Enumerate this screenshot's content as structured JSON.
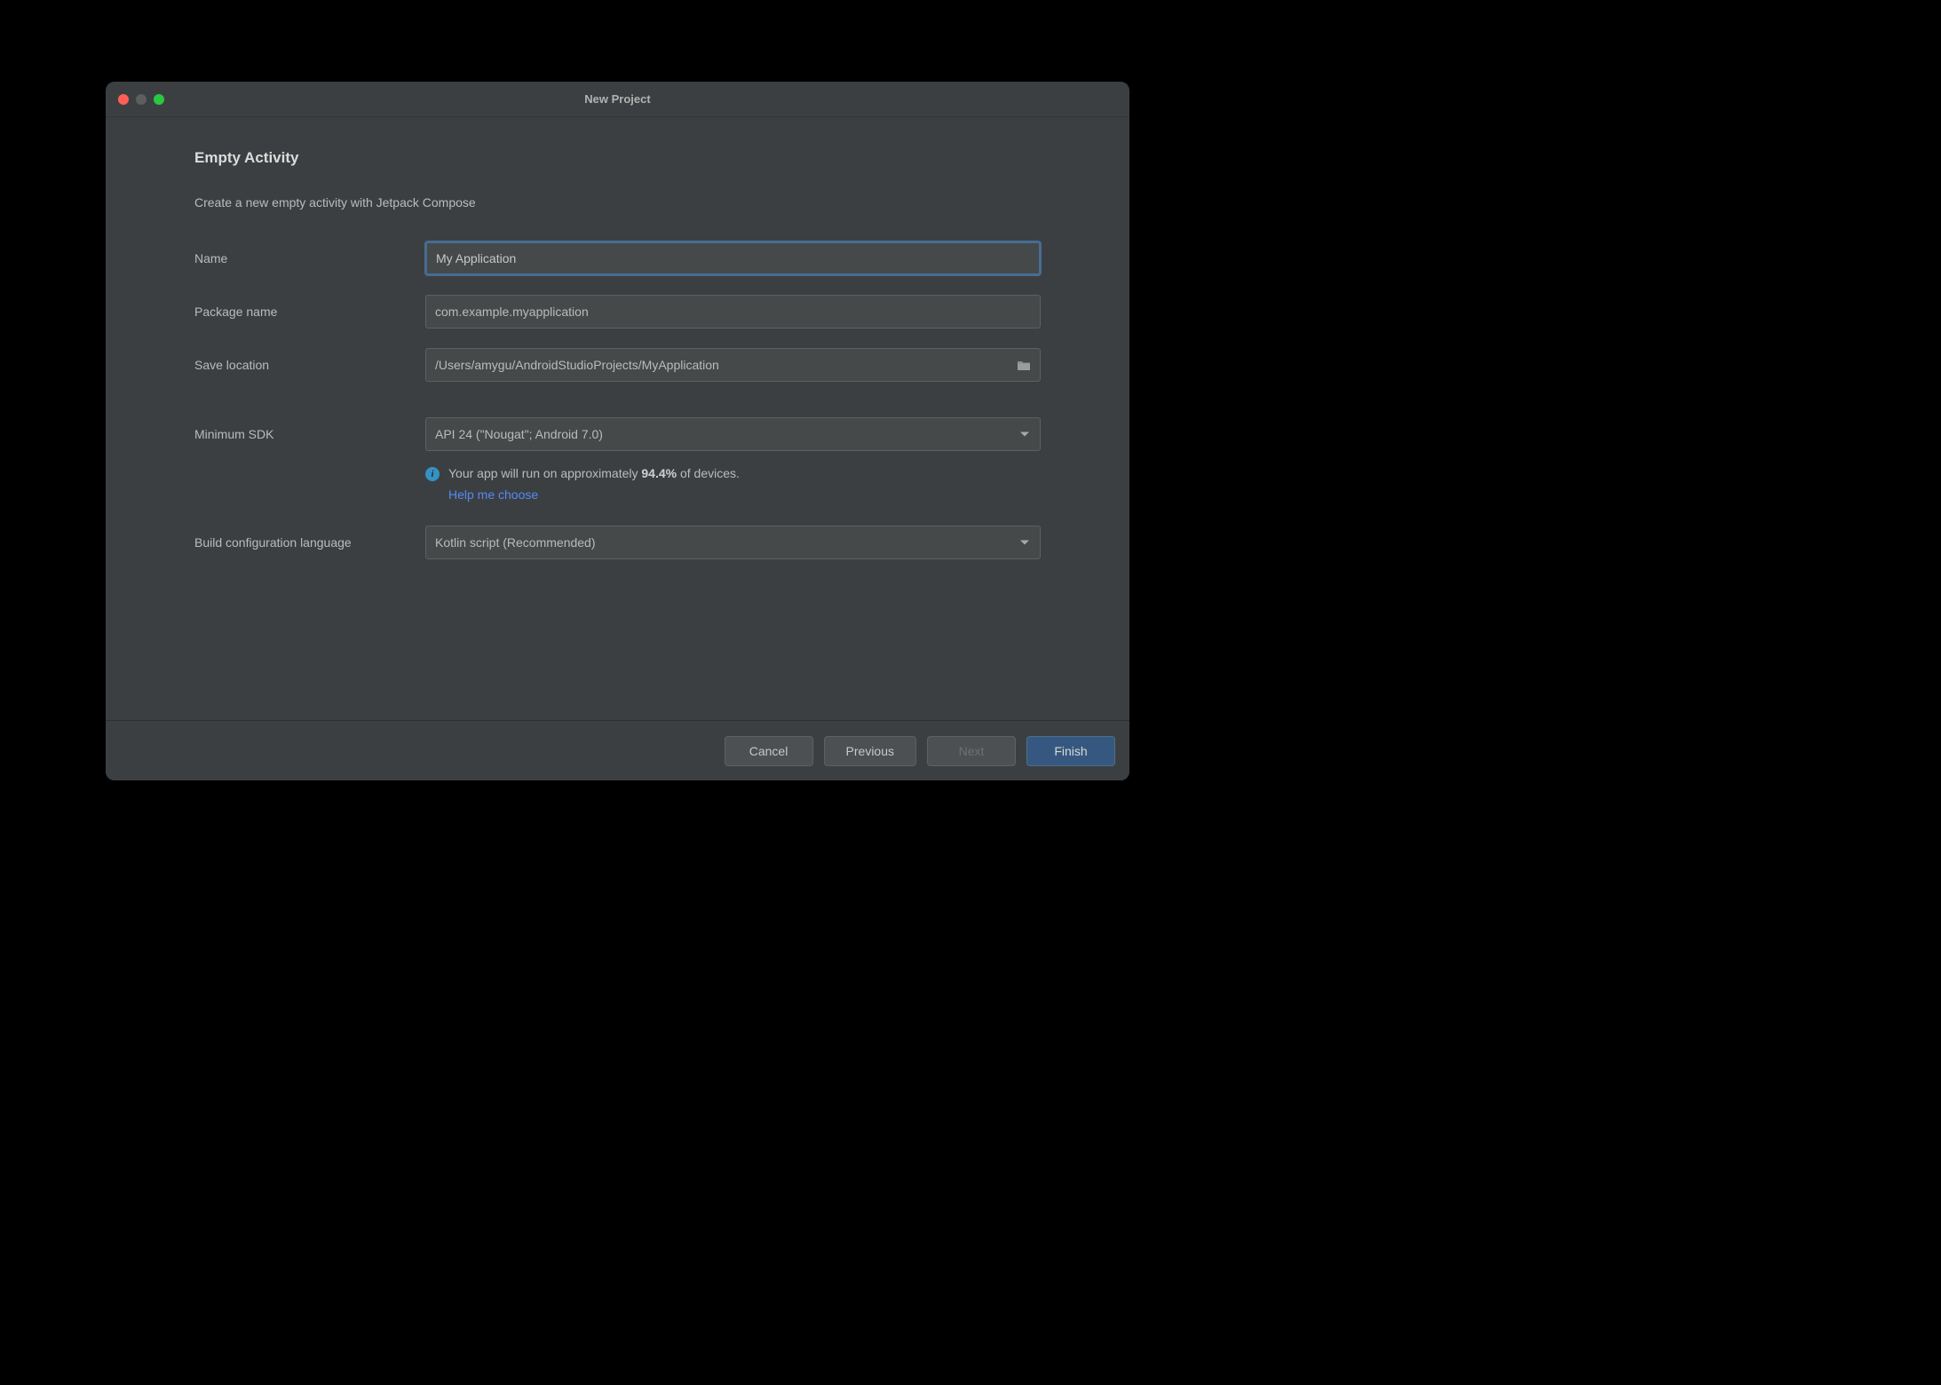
{
  "window": {
    "title": "New Project"
  },
  "heading": "Empty Activity",
  "description": "Create a new empty activity with Jetpack Compose",
  "form": {
    "name": {
      "label": "Name",
      "value": "My Application"
    },
    "package": {
      "label": "Package name",
      "value": "com.example.myapplication"
    },
    "location": {
      "label": "Save location",
      "value": "/Users/amygu/AndroidStudioProjects/MyApplication"
    },
    "minsdk": {
      "label": "Minimum SDK",
      "value": "API 24 (\"Nougat\"; Android 7.0)"
    },
    "buildlang": {
      "label": "Build configuration language",
      "value": "Kotlin script (Recommended)"
    }
  },
  "info": {
    "prefix": "Your app will run on approximately ",
    "percentage": "94.4%",
    "suffix": " of devices.",
    "help_link": "Help me choose"
  },
  "buttons": {
    "cancel": "Cancel",
    "previous": "Previous",
    "next": "Next",
    "finish": "Finish"
  }
}
